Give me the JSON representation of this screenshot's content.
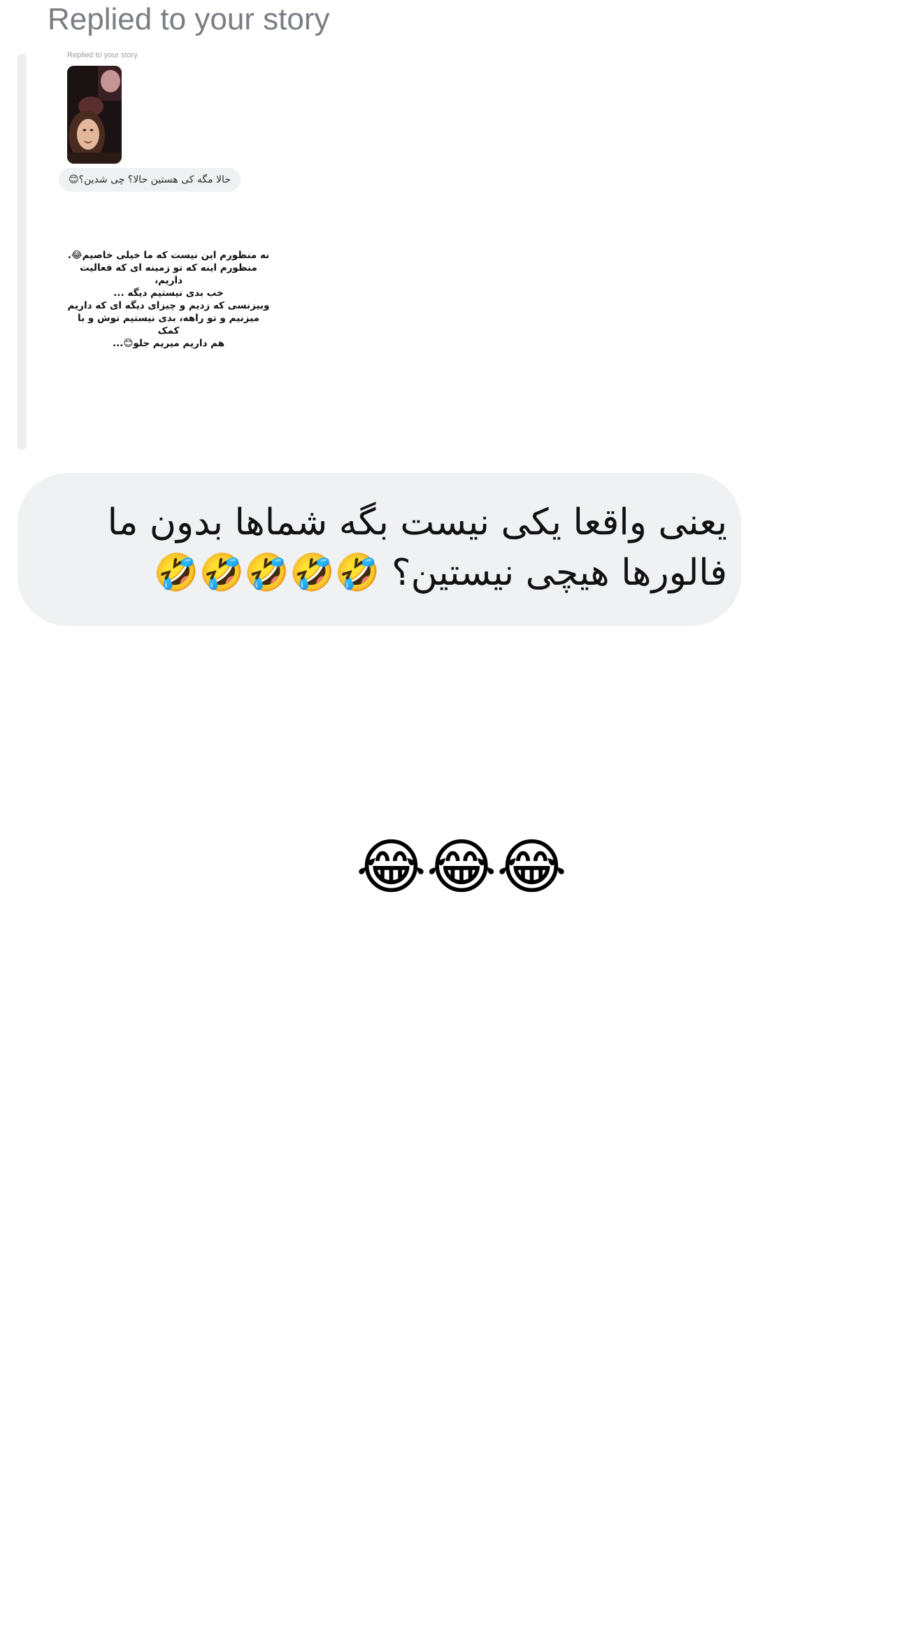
{
  "reply": {
    "header": "Replied to your story",
    "story": {
      "label": "Replied to your story",
      "bubble_text": "حالا مگه کی هستین حالا؟ چی شدین؟😊",
      "text": "نه منظورم این نیست که ما خیلی خاصیم😂.\nمنظورم اینه که تو زمینه ای که فعالیت داریم،\nخب بدی نیستیم دیگه ...\nوبیزنسی که زدیم و چیزای دیگه ای که داریم\nمیزنیم و تو راهه، بدی نیستیم توش و با کمک\nهم داریم میریم جلو😊..."
    }
  },
  "message": {
    "text": "یعنی واقعا یکی نیست بگه شماها بدون ما فالورها هیچی نیستین؟ 🤣🤣🤣🤣🤣"
  },
  "reaction": {
    "text": "😂😂😂"
  },
  "colors": {
    "bubble": "#eff1f3",
    "header_text": "#7a7d82",
    "quote_bar": "#eceef0"
  }
}
